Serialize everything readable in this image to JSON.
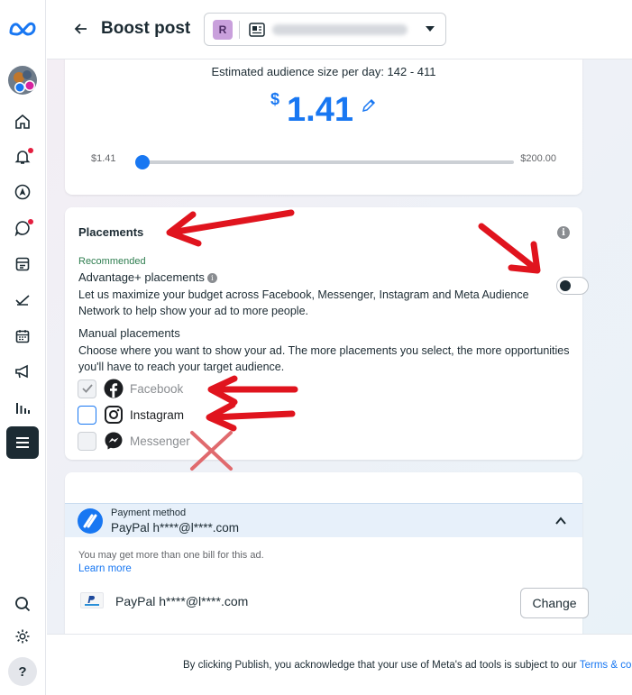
{
  "header": {
    "title": "Boost post",
    "page_selector": {
      "avatar_letter": "R"
    }
  },
  "budget": {
    "audience_text": "Estimated audience size per day: 142 - 411",
    "currency": "$",
    "amount": "1.41",
    "slider_min": "$1.41",
    "slider_max": "$200.00",
    "slider_value_fraction": 0
  },
  "placements": {
    "heading": "Placements",
    "recommended": "Recommended",
    "advantage_title": "Advantage+ placements",
    "advantage_desc": "Let us maximize your budget across Facebook, Messenger, Instagram and Meta Audience Network to help show your ad to more people.",
    "advantage_enabled": false,
    "manual_title": "Manual placements",
    "manual_desc": "Choose where you want to show your ad. The more placements you select, the more opportunities you'll have to reach your target audience.",
    "options": [
      {
        "label": "Facebook",
        "checked": true,
        "disabled": true
      },
      {
        "label": "Instagram",
        "checked": false,
        "disabled": false
      },
      {
        "label": "Messenger",
        "checked": false,
        "disabled": true
      }
    ]
  },
  "payment": {
    "label": "Payment method",
    "method": "PayPal h****@l****.com",
    "note": "You may get more than one bill for this ad.",
    "learn_more": "Learn more",
    "account_line": "PayPal h****@l****.com",
    "change_label": "Change"
  },
  "footer": {
    "text": "By clicking Publish, you acknowledge that your use of Meta's ad tools is subject to our ",
    "link": "Terms & conditi"
  },
  "colors": {
    "accent": "#1877f2",
    "annotation": "#e0141e"
  }
}
